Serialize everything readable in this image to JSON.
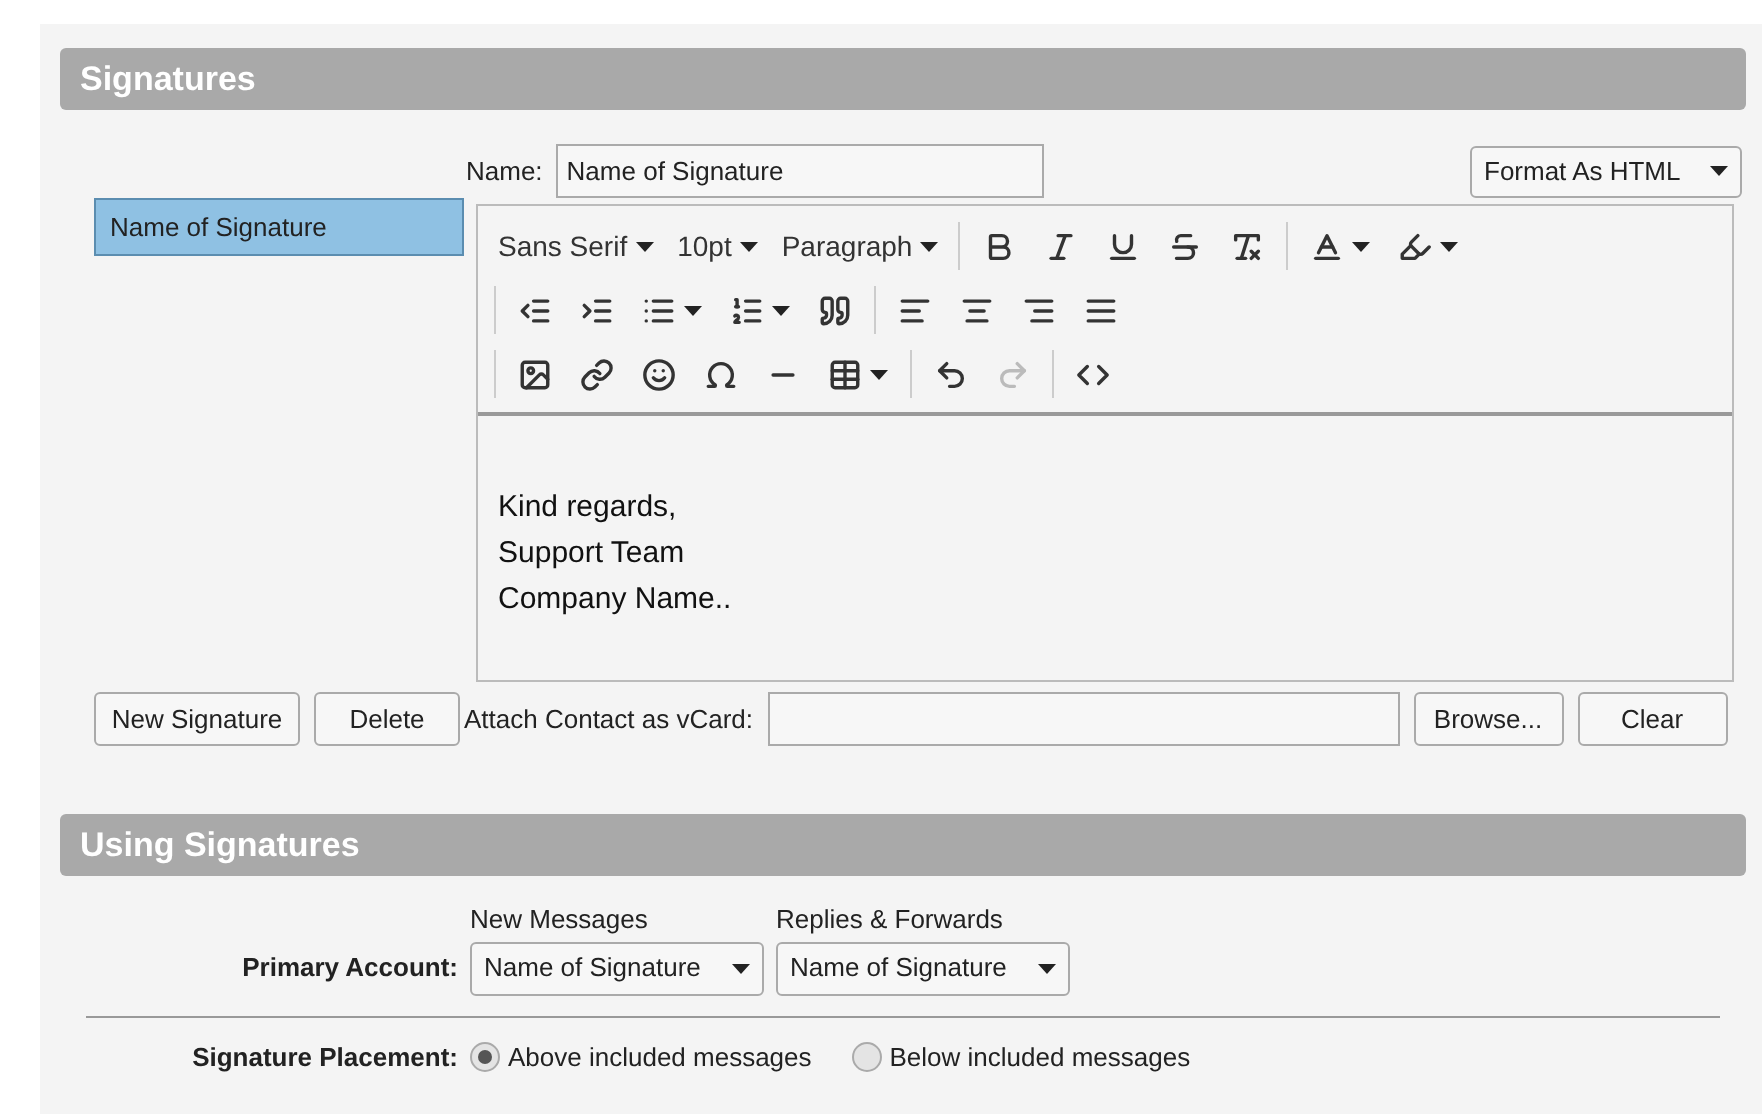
{
  "signatures": {
    "title": "Signatures",
    "list": [
      {
        "label": "Name of Signature",
        "selected": true
      }
    ],
    "name_label": "Name:",
    "name_value": "Name of Signature",
    "format": "Format As HTML",
    "toolbar": {
      "font": "Sans Serif",
      "size": "10pt",
      "block": "Paragraph",
      "redo_disabled": true
    },
    "body": [
      "Kind regards,",
      "Support Team",
      "Company Name.."
    ],
    "buttons": [
      "New Signature",
      "Delete"
    ],
    "vcard_label": "Attach Contact as vCard:",
    "vcard_buttons": [
      "Browse...",
      "Clear"
    ]
  },
  "using": {
    "title": "Using Signatures",
    "columns": [
      "New Messages",
      "Replies & Forwards"
    ],
    "account_label": "Primary Account:",
    "account_values": [
      "Name of Signature",
      "Name of Signature"
    ],
    "placement_label": "Signature Placement:",
    "placement_options": [
      {
        "label": "Above included messages",
        "selected": true
      },
      {
        "label": "Below included messages",
        "selected": false
      }
    ]
  }
}
